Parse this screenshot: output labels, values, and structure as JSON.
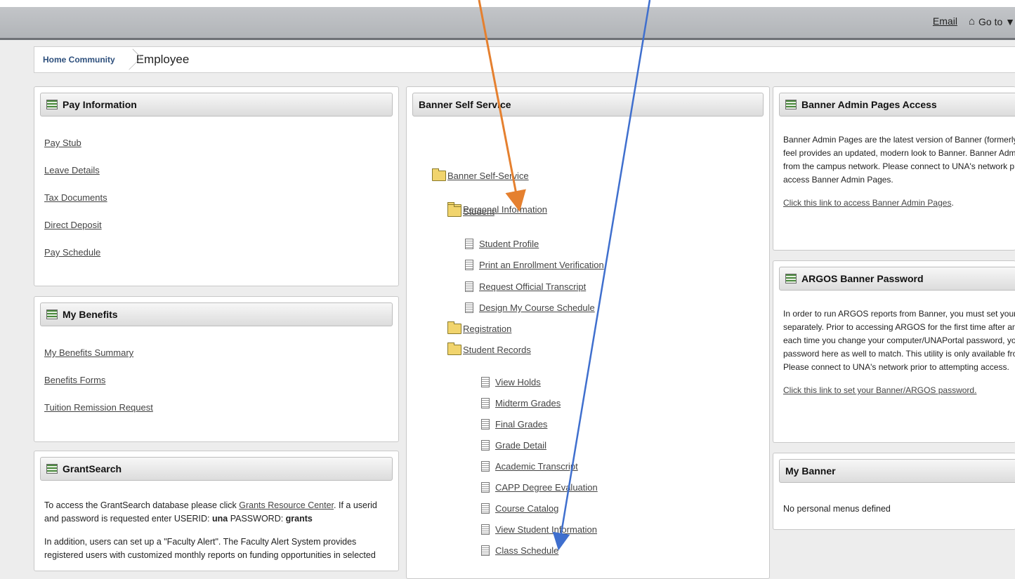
{
  "topbar": {
    "email_label": "Email",
    "goto_label": "Go to ▼"
  },
  "breadcrumb": {
    "home": "Home Community",
    "current": "Employee"
  },
  "pay": {
    "title": "Pay Information",
    "links": [
      "Pay Stub",
      "Leave Details",
      "Tax Documents",
      "Direct Deposit",
      "Pay Schedule"
    ]
  },
  "benefits": {
    "title": "My Benefits",
    "links": [
      "My Benefits Summary",
      "Benefits Forms",
      "Tuition Remission Request"
    ]
  },
  "grant": {
    "title": "GrantSearch",
    "p1_a": "To access the GrantSearch database please click ",
    "p1_link": "Grants Resource Center",
    "p1_b": ".  If a userid and password is requested enter USERID: ",
    "p1_user": "una",
    "p1_c": " PASSWORD: ",
    "p1_pass": "grants",
    "p2": "In addition, users can set up a \"Faculty Alert\".  The Faculty Alert System provides registered users with customized monthly reports on funding opportunities in selected"
  },
  "banner": {
    "title": "Banner Self Service",
    "root": "Banner Self-Service",
    "personal": "Personal Information",
    "student": "Student",
    "student_items": [
      "Student Profile",
      "Print an Enrollment Verification",
      "Request Official Transcript",
      "Design My Course Schedule"
    ],
    "registration": "Registration",
    "records": "Student Records",
    "records_items": [
      "View Holds",
      "Midterm Grades",
      "Final Grades",
      "Grade Detail",
      "Academic Transcript",
      "CAPP Degree Evaluation",
      "Course Catalog",
      "View Student Information",
      "Class Schedule"
    ]
  },
  "admin": {
    "title": "Banner Admin Pages Access",
    "text": "Banner Admin Pages are the latest version of Banner (formerly INB). The new look and feel provides an updated, modern look to Banner.  Banner Admin Pages is only available from the campus network.  Please connect to UNA's network prior to attempting to access Banner Admin Pages.",
    "link": "Click this link to access Banner Admin Pages",
    "link_tail": "."
  },
  "argos": {
    "title": "ARGOS Banner Password",
    "text": "In order to run ARGOS reports from Banner, you must set your Banner password separately. Prior to accessing ARGOS for the first time after an account is created and each time you change your computer/UNAPortal password, you must change your password here as well to match. This utility is only available from the campus network. Please connect to UNA's network prior to attempting access.",
    "link": "Click this link to set your Banner/ARGOS password."
  },
  "mybanner": {
    "title": "My Banner",
    "text": "No personal menus defined"
  },
  "colors": {
    "arrow_orange": "#e5802f",
    "arrow_blue": "#3f6fce"
  }
}
